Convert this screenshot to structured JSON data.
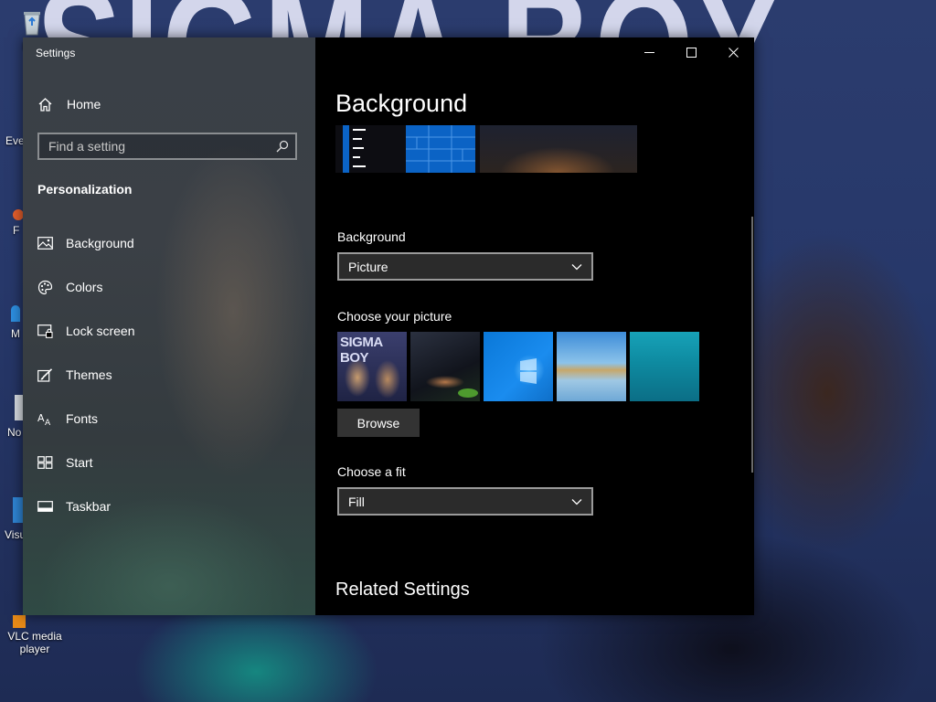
{
  "window": {
    "title": "Settings"
  },
  "sidebar": {
    "home_label": "Home",
    "search_placeholder": "Find a setting",
    "section_title": "Personalization",
    "items": [
      {
        "label": "Background",
        "icon": "picture-icon"
      },
      {
        "label": "Colors",
        "icon": "palette-icon"
      },
      {
        "label": "Lock screen",
        "icon": "lock-screen-icon"
      },
      {
        "label": "Themes",
        "icon": "brush-icon"
      },
      {
        "label": "Fonts",
        "icon": "fonts-icon"
      },
      {
        "label": "Start",
        "icon": "start-icon"
      },
      {
        "label": "Taskbar",
        "icon": "taskbar-icon"
      }
    ]
  },
  "content": {
    "title": "Background",
    "background_label": "Background",
    "background_value": "Picture",
    "choose_picture_label": "Choose your picture",
    "thumb_1_text": "SIGMA BOY",
    "browse_label": "Browse",
    "fit_label": "Choose a fit",
    "fit_value": "Fill",
    "related_title": "Related Settings"
  },
  "desktop": {
    "wallpaper_text": "SIGMA BOY",
    "icons": [
      {
        "label": "Rec"
      },
      {
        "label": "Eve"
      },
      {
        "label": "F"
      },
      {
        "label": "M"
      },
      {
        "label": "No"
      },
      {
        "label": "Visu"
      },
      {
        "label": "VLC media player"
      }
    ]
  },
  "colors": {
    "accent": "#0b63c5",
    "window_bg": "#000000",
    "dropdown_bg": "#2b2b2b",
    "button_bg": "#333333"
  }
}
